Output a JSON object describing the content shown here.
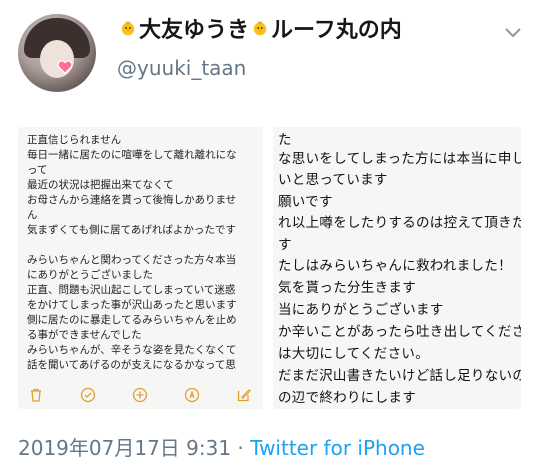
{
  "profile": {
    "display_name_part1": "大友ゆうき",
    "display_name_part2": "ルーフ丸の内",
    "handle": "@yuuki_taan"
  },
  "memo_left": {
    "lines": [
      "正直信じられません",
      "毎日一緒に居たのに喧嘩をして離れ離れにな",
      "って",
      "最近の状況は把握出来てなくて",
      "お母さんから連絡を貰って後悔しかありませ",
      "ん",
      "気まずくても側に居てあげればよかったです",
      "",
      "みらいちゃんと関わってくださった方々本当",
      "にありがとうございました",
      "正直、問題も沢山起こしてしまっていて迷惑",
      "をかけてしまった事が沢山あったと思います",
      "側に居たのに暴走してるみらいちゃんを止め",
      "る事ができませんでした",
      "みらいちゃんが、辛そうな姿を見たくなくて",
      "話を聞いてあげるのが支えになるかなって思"
    ]
  },
  "memo_right": {
    "lines": [
      "た",
      "な思いをしてしまった方には本当に申し",
      "いと思っています",
      "願いです",
      "れ以上噂をしたりするのは控えて頂きた",
      "す",
      "たしはみらいちゃんに救われました！",
      "気を貰った分生きます",
      "当にありがとうございます",
      "か辛いことがあったら吐き出してくださ",
      "は大切にしてください。",
      "だまだ沢山書きたいけど話し足りないの",
      "の辺で終わりにします"
    ]
  },
  "tweet_meta": {
    "date": "2019年07月17日 9:31",
    "separator": " · ",
    "source": "Twitter for iPhone"
  },
  "colors": {
    "link": "#1da1f2",
    "secondary_text": "#657786",
    "primary_text": "#14171a",
    "toolbar_icon": "#e0a030"
  },
  "icons": [
    "chick-emoji-icon",
    "chevron-down-icon",
    "trash-icon",
    "checkmark-icon",
    "plus-icon",
    "pen-icon",
    "compose-icon"
  ]
}
